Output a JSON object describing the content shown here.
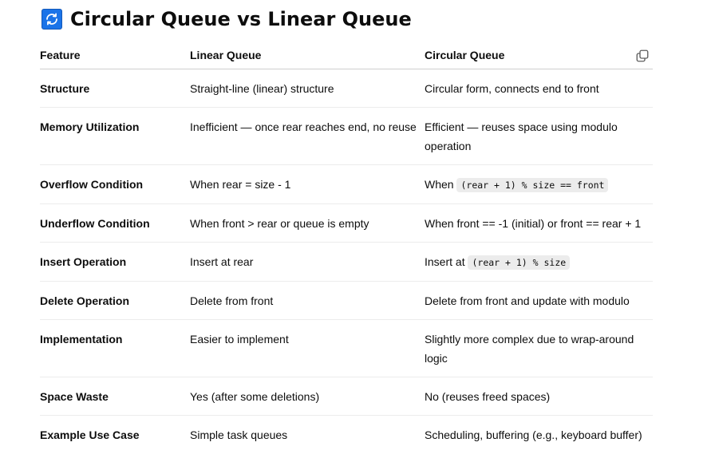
{
  "heading": {
    "icon": "refresh-icon",
    "title": "Circular Queue vs Linear Queue"
  },
  "colors": {
    "icon_bg": "#1a73e8",
    "text": "#0d0d0d",
    "code_bg": "#ececec",
    "border": "#e5e5e5"
  },
  "table": {
    "headers": [
      "Feature",
      "Linear Queue",
      "Circular Queue"
    ],
    "copy_icon": "copy-icon",
    "rows": [
      {
        "feature": "Structure",
        "linear": "Straight-line (linear) structure",
        "circular_pre": "Circular form, connects end to front",
        "circular_code": "",
        "circular_post": ""
      },
      {
        "feature": "Memory Utilization",
        "linear": "Inefficient — once rear reaches end, no reuse",
        "circular_pre": "Efficient — reuses space using modulo operation",
        "circular_code": "",
        "circular_post": ""
      },
      {
        "feature": "Overflow Condition",
        "linear": "When rear = size - 1",
        "circular_pre": "When ",
        "circular_code": "(rear + 1) % size == front",
        "circular_post": ""
      },
      {
        "feature": "Underflow Condition",
        "linear": "When front > rear or queue is empty",
        "circular_pre": "When front == -1 (initial) or front == rear + 1",
        "circular_code": "",
        "circular_post": ""
      },
      {
        "feature": "Insert Operation",
        "linear": "Insert at rear",
        "circular_pre": "Insert at ",
        "circular_code": "(rear + 1) % size",
        "circular_post": ""
      },
      {
        "feature": "Delete Operation",
        "linear": "Delete from front",
        "circular_pre": "Delete from front and update with modulo",
        "circular_code": "",
        "circular_post": ""
      },
      {
        "feature": "Implementation",
        "linear": "Easier to implement",
        "circular_pre": "Slightly more complex due to wrap-around logic",
        "circular_code": "",
        "circular_post": ""
      },
      {
        "feature": "Space Waste",
        "linear": "Yes (after some deletions)",
        "circular_pre": "No (reuses freed spaces)",
        "circular_code": "",
        "circular_post": ""
      },
      {
        "feature": "Example Use Case",
        "linear": "Simple task queues",
        "circular_pre": "Scheduling, buffering (e.g., keyboard buffer)",
        "circular_code": "",
        "circular_post": ""
      }
    ]
  }
}
